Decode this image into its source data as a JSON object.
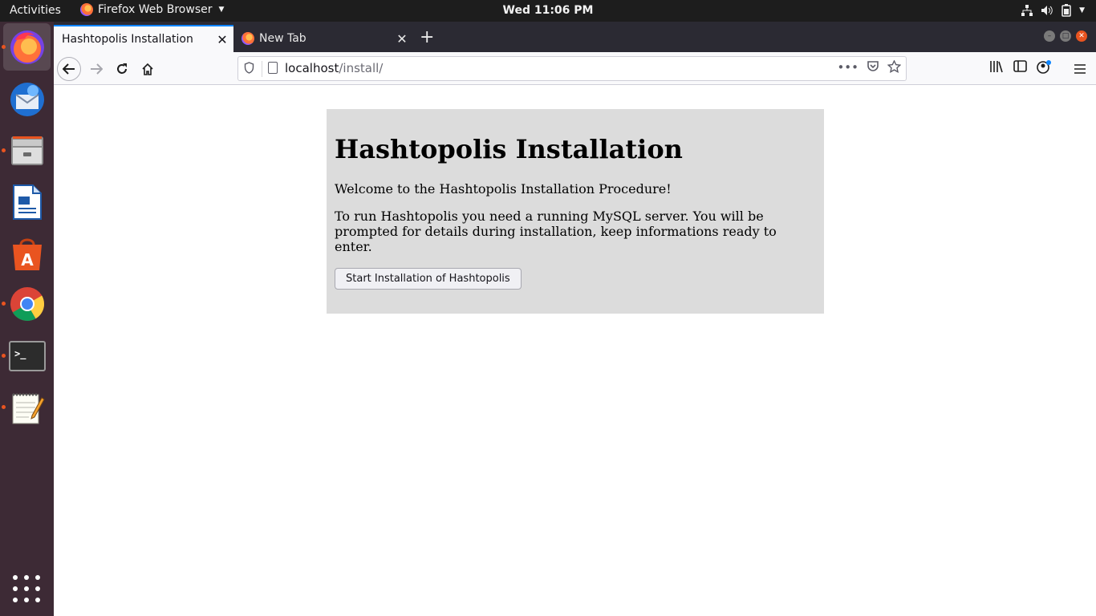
{
  "topbar": {
    "activities": "Activities",
    "app_menu": "Firefox Web Browser",
    "clock": "Wed 11:06 PM",
    "tray_icons": [
      "network-icon",
      "volume-icon",
      "battery-icon",
      "system-menu-caret-icon"
    ]
  },
  "dock": {
    "items": [
      {
        "name": "firefox",
        "icon": "firefox-icon",
        "active": true,
        "running": true
      },
      {
        "name": "thunderbird",
        "icon": "thunderbird-icon",
        "active": false,
        "running": false
      },
      {
        "name": "files",
        "icon": "files-icon",
        "active": false,
        "running": true
      },
      {
        "name": "libreoffice-writer",
        "icon": "writer-icon",
        "active": false,
        "running": false
      },
      {
        "name": "ubuntu-software",
        "icon": "software-icon",
        "active": false,
        "running": false
      },
      {
        "name": "chrome",
        "icon": "chrome-icon",
        "active": false,
        "running": true
      },
      {
        "name": "terminal",
        "icon": "terminal-icon",
        "active": false,
        "running": true
      },
      {
        "name": "text-editor",
        "icon": "text-editor-icon",
        "active": false,
        "running": true
      }
    ],
    "show_apps_icon": "apps-grid-icon"
  },
  "browser": {
    "tabs": [
      {
        "label": "Hashtopolis Installation",
        "active": true
      },
      {
        "label": "New Tab",
        "active": false
      }
    ],
    "new_tab_symbol": "+",
    "url": {
      "host": "localhost",
      "path": "/install/"
    }
  },
  "page": {
    "heading": "Hashtopolis Installation",
    "welcome": "Welcome to the Hashtopolis Installation Procedure!",
    "requirements": "To run Hashtopolis you need a running MySQL server. You will be prompted for details during installation, keep informations ready to enter.",
    "start_button": "Start Installation of Hashtopolis",
    "box_color": "#dcdcdc"
  },
  "colors": {
    "topbar": "#1d1d1d",
    "dock": "#3d2a35",
    "tabbar": "#2b2a33",
    "accent": "#0a84ff",
    "running_dot": "#e95420"
  }
}
